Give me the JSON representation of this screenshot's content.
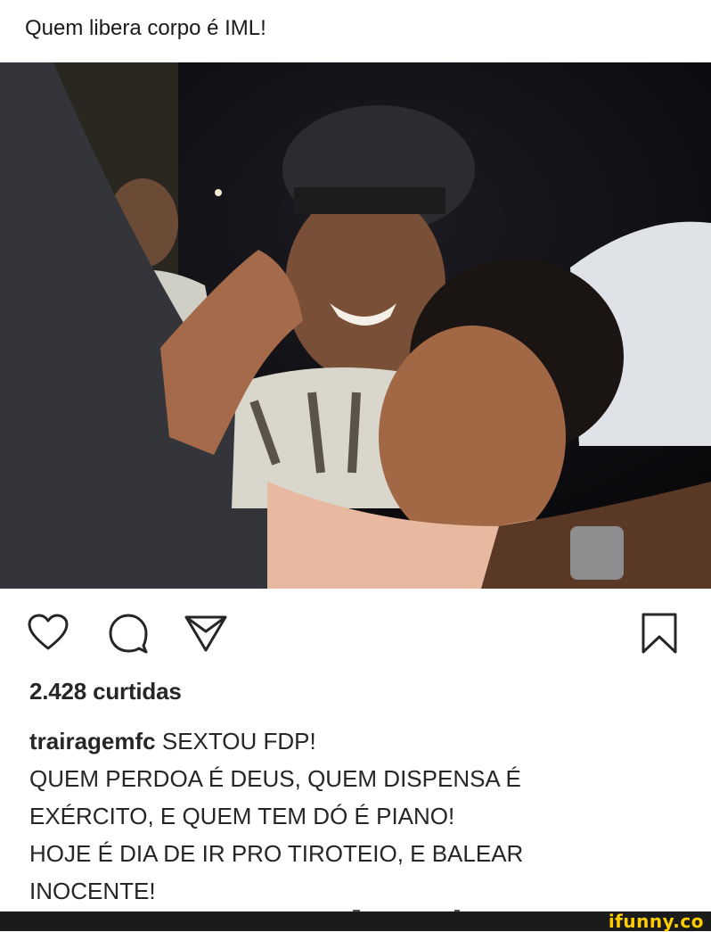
{
  "post": {
    "top_caption": "Quem libera corpo é IML!",
    "likes": "2.428 curtidas",
    "username": "trairagemfc",
    "caption_first": "SEXTOU FDP!",
    "caption_lines": [
      "QUEM PERDOA É DEUS, QUEM DISPENSA É",
      "EXÉRCITO, E QUEM TEM DÓ É PIANO!",
      "HOJE É DIA DE IR PRO TIROTEIO, E BALEAR",
      "INOCENTE!"
    ]
  },
  "actions": {
    "like_icon": "heart-outline-icon",
    "comment_icon": "comment-bubble-icon",
    "share_icon": "paper-plane-icon",
    "save_icon": "bookmark-outline-icon"
  },
  "watermark": {
    "text": "ifunny.co",
    "color": "#ffcc00"
  }
}
